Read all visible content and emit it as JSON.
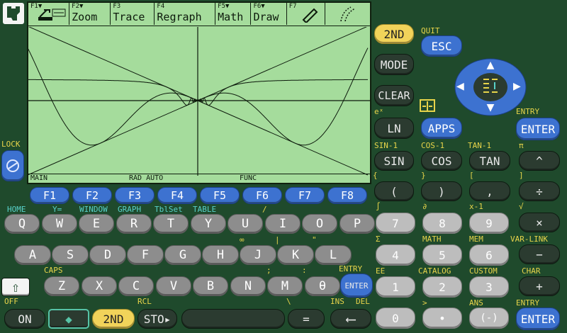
{
  "screen": {
    "toolbar": [
      {
        "fkey": "F1▼",
        "label": ""
      },
      {
        "fkey": "F2▼",
        "label": "Zoom"
      },
      {
        "fkey": "F3",
        "label": "Trace"
      },
      {
        "fkey": "F4",
        "label": "Regraph"
      },
      {
        "fkey": "F5▼",
        "label": "Math"
      },
      {
        "fkey": "F6▼",
        "label": "Draw"
      },
      {
        "fkey": "F7",
        "label": ""
      }
    ],
    "status": {
      "left": "MAIN",
      "mid": "RAD AUTO",
      "right": "FUNC"
    }
  },
  "colors": {
    "background": "#1f4a2c",
    "screen": "#a5dc9c",
    "yellow_label": "#e7d44a",
    "cyan_label": "#58d1c9",
    "blue_key": "#3d72d0",
    "grey_key": "#8d8d8d"
  },
  "fkeys": [
    "F1",
    "F2",
    "F3",
    "F4",
    "F5",
    "F6",
    "F7",
    "F8"
  ],
  "qwerty": {
    "row1": [
      "Q",
      "W",
      "E",
      "R",
      "T",
      "Y",
      "U",
      "I",
      "O",
      "P"
    ],
    "row2": [
      "A",
      "S",
      "D",
      "F",
      "G",
      "H",
      "J",
      "K",
      "L"
    ],
    "row3": [
      "Z",
      "X",
      "C",
      "V",
      "B",
      "N",
      "M",
      "θ"
    ]
  },
  "shift_labels": {
    "home": "HOME",
    "yeq": "Y=",
    "window": "WINDOW",
    "graph": "GRAPH",
    "tblset": "TblSet",
    "table": "TABLE",
    "caps": "CAPS",
    "off": "OFF",
    "rcl": "RCL",
    "ins": "INS",
    "del": "DEL",
    "entry": "ENTRY",
    "lock": "LOCK",
    "quit": "QUIT",
    "ex": "eˣ",
    "sin1": "SIN-1",
    "cos1": "COS-1",
    "tan1": "TAN-1",
    "pi": "π",
    "math": "MATH",
    "mem": "MEM",
    "varlink": "VAR-LINK",
    "catalog": "CATALOG",
    "custom": "CUSTOM",
    "char": "CHAR",
    "ee": "EE",
    "ans": "ANS",
    "inf": "∞",
    "x1": "x-1",
    "sqrt": "√",
    "sum": "Σ",
    "int": "∫",
    "del2": "∂",
    "bracket_l": "[",
    "bracket_r": "]",
    "brace_l": "{",
    "brace_r": "}"
  },
  "right_keys": {
    "second": "2ND",
    "esc": "ESC",
    "mode": "MODE",
    "clear": "CLEAR",
    "ln": "LN",
    "apps": "APPS",
    "enter_top": "ENTER",
    "sin": "SIN",
    "cos": "COS",
    "tan": "TAN",
    "pow": "^",
    "lparen": "(",
    "rparen": ")",
    "comma": ",",
    "div": "÷",
    "n7": "7",
    "n8": "8",
    "n9": "9",
    "mul": "×",
    "n4": "4",
    "n5": "5",
    "n6": "6",
    "minus": "−",
    "n1": "1",
    "n2": "2",
    "n3": "3",
    "plus": "+",
    "n0": "0",
    "dot": "•",
    "neg": "(-)",
    "enter_bot": "ENTER"
  },
  "bottom_keys": {
    "on": "ON",
    "diamond": "◆",
    "second": "2ND",
    "sto": "STO▸",
    "space": "",
    "equals": "=",
    "backspace": "⟵",
    "enter_mid": "ENTER",
    "shift": "⇧"
  }
}
